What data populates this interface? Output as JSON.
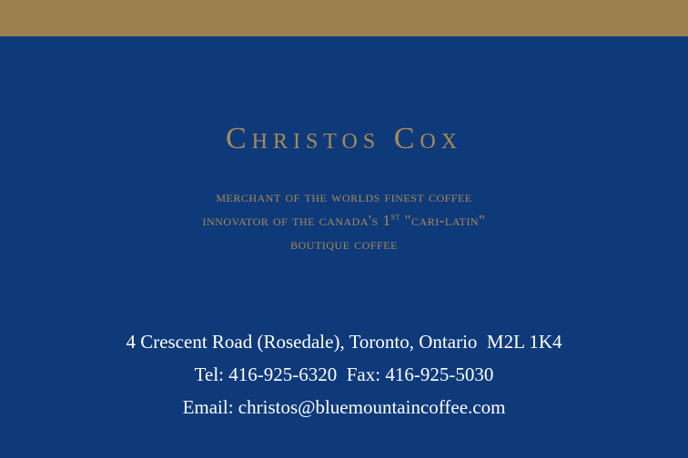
{
  "card": {
    "name": "Christos Cox",
    "tagline_1": "MERCHANT OF THE WORLDS FINEST COFFEE",
    "tagline_2_pre": "INNOVATOR OF THE CANADA'S 1",
    "tagline_2_sup": "ST",
    "tagline_2_post": " \"CARI-LATIN\"",
    "tagline_3": "BOUTIQUE COFFEE",
    "address": "4 Crescent Road (Rosedale), Toronto, Ontario  M2L 1K4",
    "phone_line": "Tel: 416-925-6320  Fax: 416-925-5030",
    "email_line": "Email: christos@bluemountaincoffee.com"
  },
  "colors": {
    "background": "#0e3a7a",
    "gold": "#a88a55",
    "gold_bar": "#9b814e",
    "contact_text": "#ffffff"
  }
}
